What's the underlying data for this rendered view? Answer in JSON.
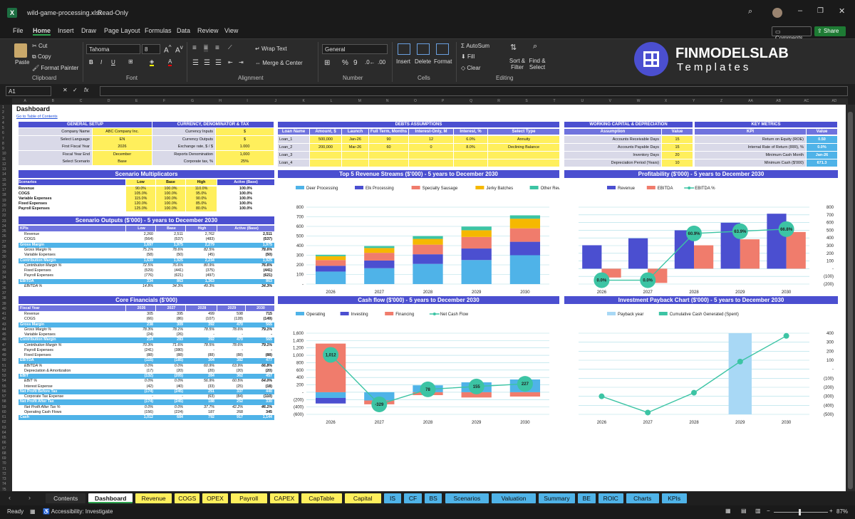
{
  "window": {
    "filename": "wild-game-processing.xlsx",
    "mode": "Read-Only",
    "search_icon": "search-icon"
  },
  "menu": [
    "File",
    "Home",
    "Insert",
    "Draw",
    "Page Layout",
    "Formulas",
    "Data",
    "Review",
    "View"
  ],
  "menu_right": {
    "comments": "Comments",
    "share": "Share"
  },
  "ribbon": {
    "paste": "Paste",
    "cut": "Cut",
    "copy": "Copy",
    "format_painter": "Format Painter",
    "clipboard": "Clipboard",
    "font_name": "Tahoma",
    "font_size": "8",
    "font": "Font",
    "wrap_text": "Wrap Text",
    "merge_center": "Merge & Center",
    "alignment": "Alignment",
    "number_format": "General",
    "number": "Number",
    "insert": "Insert",
    "delete": "Delete",
    "format": "Format",
    "cells": "Cells",
    "autosum": "AutoSum",
    "fill": "Fill",
    "clear": "Clear",
    "sort_filter": "Sort & Filter",
    "find_select": "Find & Select",
    "editing": "Editing",
    "logo_title": "FINMODELSLAB",
    "logo_sub": "Templates"
  },
  "formula_bar": {
    "cell": "A1",
    "fx": "fx",
    "value": ""
  },
  "columns": [
    "A",
    "B",
    "C",
    "D",
    "E",
    "F",
    "G",
    "H",
    "I",
    "J",
    "K",
    "L",
    "M",
    "N",
    "O",
    "P",
    "Q",
    "R",
    "S",
    "T",
    "U",
    "V",
    "W",
    "X",
    "Y",
    "Z",
    "AA",
    "AB",
    "AC",
    "AD"
  ],
  "dashboard": {
    "title": "Dashboard",
    "toc_link": "Go to Table of Contents",
    "general_setup": {
      "title": "GENERAL SETUP",
      "rows": [
        [
          "Company Name",
          "ABC Company Inc."
        ],
        [
          "Select Language",
          "EN"
        ],
        [
          "First Fiscal Year",
          "2026"
        ],
        [
          "Fiscal Year End",
          "December"
        ],
        [
          "Select Scenario",
          "Base"
        ]
      ]
    },
    "currency": {
      "title": "CURRENCY, DENOMINATOR & TAX",
      "rows": [
        [
          "Currency Inputs",
          "$"
        ],
        [
          "Currency Outputs",
          "$"
        ],
        [
          "Exchange rate, $ / $",
          "1.000"
        ],
        [
          "Reports Denomination",
          "1,000"
        ],
        [
          "Corporate tax, %",
          "25%"
        ]
      ]
    },
    "debts": {
      "title": "DEBTS ASSUMPTIONS",
      "headers": [
        "Loan Name",
        "Amount, $",
        "Launch",
        "Full Term, Months",
        "Interest-Only, M",
        "Interest, %",
        "Select Type"
      ],
      "rows": [
        [
          "Loan_1",
          "500,000",
          "Jan-26",
          "90",
          "12",
          "6.0%",
          "Annuity"
        ],
        [
          "Loan_2",
          "200,000",
          "Mar-26",
          "60",
          "0",
          "8.0%",
          "Declining Balance"
        ],
        [
          "Loan_3",
          "",
          "",
          "",
          "",
          "",
          ""
        ],
        [
          "Loan_4",
          "",
          "",
          "",
          "",
          "",
          ""
        ]
      ]
    },
    "working_capital": {
      "title": "WORKING CAPITAL & DEPRECIATION",
      "headers": [
        "Assumption",
        "Value"
      ],
      "rows": [
        [
          "Accounts Receivable Days",
          "15"
        ],
        [
          "Accounts Payable Days",
          "15"
        ],
        [
          "Inventory Days",
          "20"
        ],
        [
          "Depreciation Period (Years)",
          "10"
        ]
      ]
    },
    "key_metrics": {
      "title": "KEY METRICS",
      "headers": [
        "KPI",
        "Value"
      ],
      "rows": [
        [
          "Return on Equity (ROE)",
          "0.50"
        ],
        [
          "Internal Rate of Return (IRR), %",
          "0.0%"
        ],
        [
          "Minimum Cash Month",
          "Jan-26"
        ],
        [
          "Minimum Cash ($'000)",
          "671.3"
        ]
      ]
    },
    "scenario_mult": {
      "title": "Scenario Multiplicators",
      "headers": [
        "Scenarios",
        "Low",
        "Base",
        "High",
        "Active (Base)"
      ],
      "rows": [
        [
          "Revenue",
          "90.0%",
          "100.0%",
          "110.0%",
          "100.0%"
        ],
        [
          "COGS",
          "105.0%",
          "100.0%",
          "95.0%",
          "100.0%"
        ],
        [
          "Variable Expenses",
          "115.0%",
          "100.0%",
          "90.0%",
          "100.0%"
        ],
        [
          "Fixed Expenses",
          "120.0%",
          "100.0%",
          "85.0%",
          "100.0%"
        ],
        [
          "Payroll Expenses",
          "125.0%",
          "100.0%",
          "80.0%",
          "100.0%"
        ]
      ]
    },
    "scenario_out": {
      "title": "Scenario Outputs ($'000) - 5 years to December 2030",
      "headers": [
        "KPIs",
        "Low",
        "Base",
        "High",
        "Active (Base)"
      ],
      "rows": [
        [
          "Revenue",
          "2,260",
          "2,511",
          "2,762",
          "2,511",
          "n"
        ],
        [
          "COGS",
          "(564)",
          "(537)",
          "(483)",
          "(537)",
          "n"
        ],
        [
          "Gross Margin",
          "1,697",
          "1,975",
          "2,279",
          "1,975",
          "b"
        ],
        [
          "Gross Margin %",
          "75.1%",
          "78.6%",
          "82.5%",
          "78.6%",
          "i"
        ],
        [
          "Variable Expenses",
          "(58)",
          "(50)",
          "(45)",
          "(50)",
          "n"
        ],
        [
          "Contribution Margin",
          "1,639",
          "1,925",
          "2,234",
          "1,925",
          "b"
        ],
        [
          "Contribution Margin %",
          "72.5%",
          "76.6%",
          "80.9%",
          "76.6%",
          "i"
        ],
        [
          "Fixed Expenses",
          "(529)",
          "(441)",
          "(375)",
          "(441)",
          "n"
        ],
        [
          "Payroll Expenses",
          "(776)",
          "(621)",
          "(497)",
          "(621)",
          "n"
        ],
        [
          "EBITDA",
          "334",
          "863",
          "1,363",
          "863",
          "b"
        ],
        [
          "EBITDA %",
          "14.8%",
          "34.3%",
          "49.3%",
          "34.3%",
          "i"
        ]
      ]
    },
    "core": {
      "title": "Core Financials ($'000)",
      "headers": [
        "Fiscal Year",
        "2026",
        "2027",
        "2028",
        "2029",
        "2030"
      ],
      "rows": [
        [
          "Revenue",
          "305",
          "395",
          "499",
          "598",
          "715",
          "n"
        ],
        [
          "COGS",
          "(66)",
          "(86)",
          "(107)",
          "(128)",
          "(149)",
          "n"
        ],
        [
          "Gross Margin",
          "238",
          "309",
          "392",
          "470",
          "565",
          "b"
        ],
        [
          "Gross Margin %",
          "78.3%",
          "78.1%",
          "78.5%",
          "78.6%",
          "79.1%",
          "i"
        ],
        [
          "Variable Expenses",
          "(24)",
          "(26)",
          "-",
          "-",
          "-",
          "n"
        ],
        [
          "Contribution Margin",
          "214",
          "283",
          "392",
          "470",
          "565",
          "b"
        ],
        [
          "Contribution Margin %",
          "70.3%",
          "71.6%",
          "78.5%",
          "78.6%",
          "79.1%",
          "i"
        ],
        [
          "Payroll Expenses",
          "(241)",
          "(380)",
          "-",
          "-",
          "-",
          "n"
        ],
        [
          "Fixed Expenses",
          "(88)",
          "(88)",
          "(88)",
          "(88)",
          "(88)",
          "n"
        ],
        [
          "EBITDA",
          "(115)",
          "(185)",
          "304",
          "382",
          "477",
          "b"
        ],
        [
          "EBITDA %",
          "0.0%",
          "0.0%",
          "60.9%",
          "63.9%",
          "66.8%",
          "i"
        ],
        [
          "Depreciation & Amortization",
          "(17)",
          "(20)",
          "(20)",
          "(20)",
          "(20)",
          "n"
        ],
        [
          "EBIT",
          "(132)",
          "(205)",
          "284",
          "362",
          "457",
          "b"
        ],
        [
          "EBIT %",
          "0.0%",
          "0.0%",
          "56.9%",
          "60.5%",
          "64.0%",
          "i"
        ],
        [
          "Interest Expense",
          "(42)",
          "(40)",
          "(33)",
          "(25)",
          "(18)",
          "n"
        ],
        [
          "Net Profit Before Tax",
          "(174)",
          "(245)",
          "251",
          "337",
          "440",
          "b"
        ],
        [
          "Corporate Tax Expense",
          "-",
          "-",
          "(63)",
          "(84)",
          "(110)",
          "n"
        ],
        [
          "Net Profit After Tax",
          "(174)",
          "(245)",
          "188",
          "252",
          "330",
          "b"
        ],
        [
          "Net Profit After Tax %",
          "0.0%",
          "0.0%",
          "37.7%",
          "42.2%",
          "46.1%",
          "i"
        ],
        [
          "Operating Cash Flows",
          "(156)",
          "(224)",
          "187",
          "268",
          "345",
          "n"
        ],
        [
          "Cash",
          "1,012",
          "684",
          "792",
          "917",
          "1,144",
          "b"
        ]
      ]
    }
  },
  "charts": {
    "revenue": {
      "title": "Top 5 Revenue Streams ($'000) - 5 years to December 2030"
    },
    "profit": {
      "title": "Profitability ($'000) - 5 years to December 2030"
    },
    "cash": {
      "title": "Cash flow ($'000) - 5 years to December 2030"
    },
    "payback": {
      "title": "Investment Payback Chart ($'000) - 5 years to December 2030"
    }
  },
  "chart_data": [
    {
      "type": "bar",
      "stacked": true,
      "categories": [
        "2026",
        "2027",
        "2028",
        "2029",
        "2030"
      ],
      "ylim": [
        0,
        800
      ],
      "yticks": [
        "-",
        "100",
        "200",
        "300",
        "400",
        "500",
        "600",
        "700",
        "800"
      ],
      "legend": "top",
      "series": [
        {
          "name": "Deer Processing",
          "color": "#4fb3e8",
          "values": [
            130,
            165,
            210,
            250,
            300
          ]
        },
        {
          "name": "Elk Processing",
          "color": "#4b4fd0",
          "values": [
            60,
            80,
            100,
            120,
            140
          ]
        },
        {
          "name": "Specialty Sausage",
          "color": "#f07c6c",
          "values": [
            60,
            80,
            100,
            120,
            140
          ]
        },
        {
          "name": "Jerky Batches",
          "color": "#f5b800",
          "values": [
            40,
            50,
            60,
            70,
            100
          ]
        },
        {
          "name": "Other Revenue",
          "color": "#3cc4a4",
          "values": [
            15,
            20,
            29,
            38,
            35
          ]
        }
      ]
    },
    {
      "type": "bar",
      "categories": [
        "2026",
        "2027",
        "2028",
        "2029",
        "2030"
      ],
      "ylim": [
        -200,
        800
      ],
      "yticks": [
        "(200)",
        "(100)",
        "-",
        "100",
        "200",
        "300",
        "400",
        "500",
        "600",
        "700",
        "800"
      ],
      "legend": "top",
      "series": [
        {
          "name": "Revenue",
          "color": "#4b4fd0",
          "values": [
            305,
            395,
            499,
            598,
            715
          ]
        },
        {
          "name": "EBITDA",
          "color": "#f07c6c",
          "values": [
            -115,
            -185,
            304,
            382,
            477
          ]
        },
        {
          "name": "EBITDA %",
          "color": "#3cc4a4",
          "line": true,
          "values": [
            0,
            0,
            60.9,
            63.9,
            66.8
          ],
          "labels": [
            "0.0%",
            "0.0%",
            "60.9%",
            "63.9%",
            "66.8%"
          ]
        }
      ]
    },
    {
      "type": "bar",
      "stacked": true,
      "categories": [
        "2026",
        "2027",
        "2028",
        "2029",
        "2030"
      ],
      "ylim": [
        -600,
        1600
      ],
      "yticks": [
        "(600)",
        "(400)",
        "(200)",
        "-",
        "200",
        "400",
        "600",
        "800",
        "1,000",
        "1,200",
        "1,400",
        "1,600"
      ],
      "legend": "top",
      "series": [
        {
          "name": "Operating",
          "color": "#4fb3e8",
          "values": [
            -156,
            -224,
            187,
            268,
            345
          ]
        },
        {
          "name": "Investing",
          "color": "#4b4fd0",
          "values": [
            -150,
            0,
            0,
            0,
            0
          ]
        },
        {
          "name": "Financing",
          "color": "#f07c6c",
          "values": [
            1318,
            -104,
            -79,
            -143,
            -118
          ]
        },
        {
          "name": "Net Cash Flow",
          "color": "#3cc4a4",
          "line": true,
          "values": [
            1012,
            -329,
            78,
            155,
            227
          ],
          "labels": [
            "1,012",
            "-329",
            "78",
            "155",
            "227"
          ]
        }
      ]
    },
    {
      "type": "line",
      "categories": [
        "2026",
        "2027",
        "2028",
        "2029",
        "2030"
      ],
      "ylim": [
        -500,
        400
      ],
      "yticks": [
        "(500)",
        "(400)",
        "(300)",
        "(200)",
        "(100)",
        "-",
        "100",
        "200",
        "300",
        "400"
      ],
      "legend": "top",
      "series": [
        {
          "name": "Payback year",
          "color": "#a8d8f5",
          "bar": true,
          "values": [
            0,
            0,
            0,
            1,
            0
          ]
        },
        {
          "name": "Cumulative Cash Generated (Spent)",
          "color": "#3cc4a4",
          "values": [
            -300,
            -480,
            -260,
            85,
            370
          ]
        }
      ]
    }
  ],
  "tabs": [
    "Contents",
    "Dashboard",
    "Revenue",
    "COGS",
    "OPEX",
    "Payroll",
    "CAPEX",
    "CapTable",
    "Capital",
    "IS",
    "CF",
    "BS",
    "Scenarios",
    "Valuation",
    "Summary",
    "BE",
    "ROIC",
    "Charts",
    "KPIs"
  ],
  "status": {
    "ready": "Ready",
    "accessibility": "Accessibility: Investigate",
    "zoom": "87%"
  }
}
